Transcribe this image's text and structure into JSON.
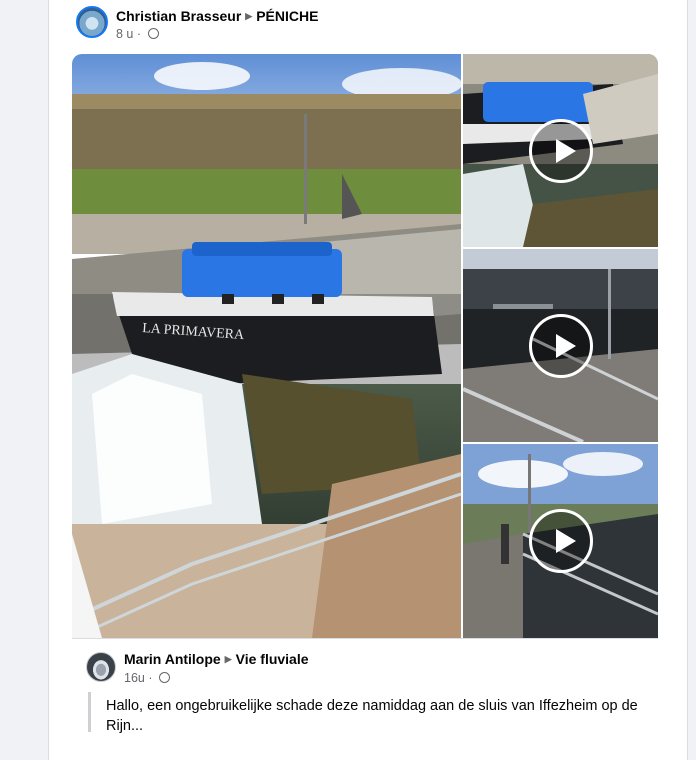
{
  "post": {
    "author": "Christian Brasseur",
    "group": "PÉNICHE",
    "time": "8 u",
    "separator": "·"
  },
  "media": {
    "main_caption": "LA PRIMAVERA",
    "videos": [
      "play-icon",
      "play-icon",
      "play-icon"
    ]
  },
  "shared_post": {
    "author": "Marin Antilope",
    "group": "Vie fluviale",
    "time": "16u",
    "separator": "·",
    "text": "Hallo, een ongebruikelijke schade deze namiddag aan de sluis van Iffezheim op de",
    "text_line2": "Rijn..."
  },
  "colors": {
    "accent": "#1877f2",
    "hull_blue": "#1d6fe0",
    "background": "#f0f2f5"
  }
}
